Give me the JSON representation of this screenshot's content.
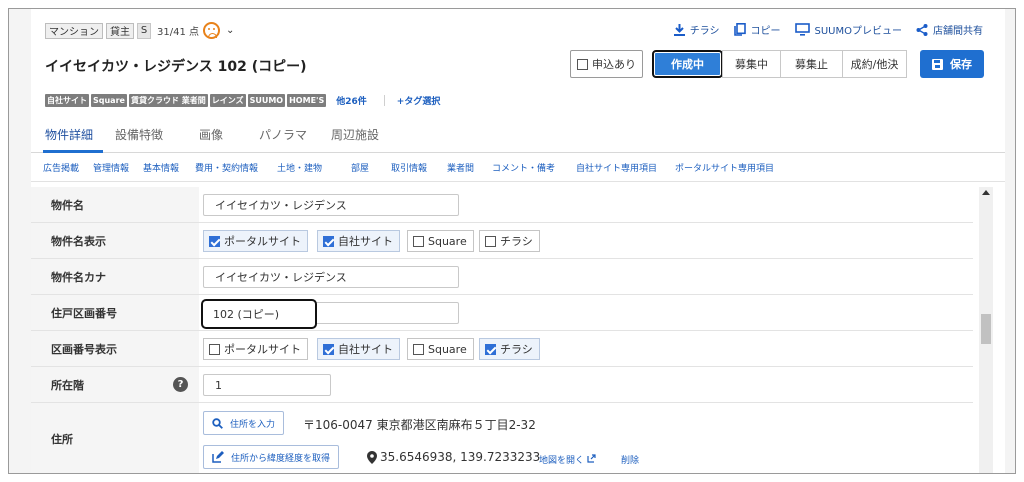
{
  "header": {
    "chip_mansion": "マンション",
    "chip_landlord": "貸主",
    "s_badge": "S",
    "score": "31/41 点",
    "caret": "⌄",
    "links": {
      "chirashi": "チラシ",
      "copy": "コピー",
      "suumo_preview": "SUUMOプレビュー",
      "share": "店舗間共有"
    }
  },
  "title": "イイセイカツ・レジデンス 102 (コピー)",
  "actions": {
    "applied_label": "申込あり",
    "applied_checked": false,
    "status_buttons": [
      "作成中",
      "募集中",
      "募集止",
      "成約/他決"
    ],
    "active_status": "作成中",
    "save_label": "保存"
  },
  "tags": {
    "items": [
      "自社サイト",
      "Square",
      "賃貸クラウド 業者間",
      "レインズ",
      "SUUMO",
      "HOME'S"
    ],
    "more": "他26件",
    "add": "+タグ選択"
  },
  "tabs": {
    "items": [
      "物件詳細",
      "設備特徴",
      "画像",
      "パノラマ",
      "周辺施設"
    ],
    "active": "物件詳細"
  },
  "subnav": [
    "広告掲載",
    "管理情報",
    "基本情報",
    "費用・契約情報",
    "土地・建物",
    "部屋",
    "取引情報",
    "業者間",
    "コメント・備考",
    "自社サイト専用項目",
    "ポータルサイト専用項目"
  ],
  "form": {
    "name_label": "物件名",
    "name_value": "イイセイカツ・レジデンス",
    "name_display_label": "物件名表示",
    "name_display_options": [
      {
        "label": "ポータルサイト",
        "checked": true
      },
      {
        "label": "自社サイト",
        "checked": true
      },
      {
        "label": "Square",
        "checked": false
      },
      {
        "label": "チラシ",
        "checked": false
      }
    ],
    "name_kana_label": "物件名カナ",
    "name_kana_value": "イイセイカツ・レジデンス",
    "room_no_label": "住戸区画番号",
    "room_no_value": "102 (コピー)",
    "room_display_label": "区画番号表示",
    "room_display_options": [
      {
        "label": "ポータルサイト",
        "checked": false
      },
      {
        "label": "自社サイト",
        "checked": true
      },
      {
        "label": "Square",
        "checked": false
      },
      {
        "label": "チラシ",
        "checked": true
      }
    ],
    "floor_label": "所在階",
    "floor_help": "?",
    "floor_value": "1",
    "address_label": "住所",
    "address_input_btn": "住所を入力",
    "address_text": "〒106-0047 東京都港区南麻布５丁目2-32",
    "geo_btn": "住所から緯度経度を取得",
    "coords": "35.6546938, 139.7233233",
    "open_map": "地図を開く",
    "delete": "削除"
  },
  "colors": {
    "accent": "#1f6fd0",
    "link": "#1d5fbf",
    "face": "#e8821a"
  }
}
